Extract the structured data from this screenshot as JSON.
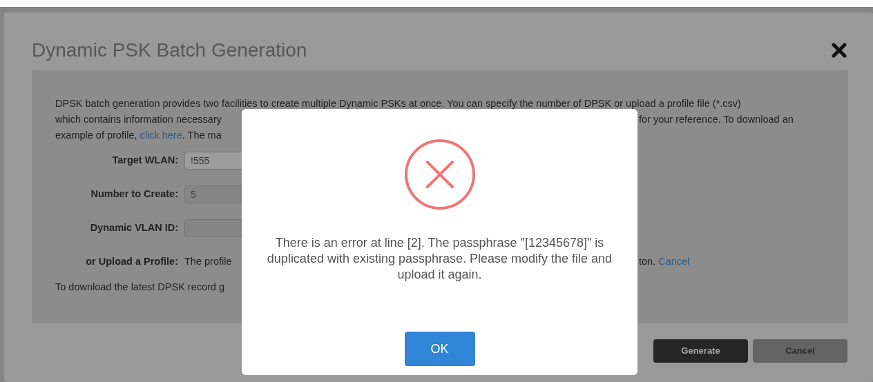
{
  "dialog": {
    "title": "Dynamic PSK Batch Generation",
    "description_lines": [
      {
        "left": [
          {
            "kind": "text",
            "text": "DPSK batch generation provides two facilities to create multiple Dynamic PSKs at once. You can specify the number of DPSK or upload a profile file (*.csv)"
          }
        ]
      },
      {
        "left": [
          {
            "kind": "text",
            "text": "which contains information necessary"
          }
        ],
        "right": [
          {
            "kind": "text",
            "text": "for your reference. To download an"
          }
        ]
      },
      {
        "left": [
          {
            "kind": "text",
            "text": "example of profile, "
          },
          {
            "kind": "link",
            "text": "click here"
          },
          {
            "kind": "text",
            "text": ". The ma"
          }
        ]
      }
    ],
    "fields": [
      {
        "label": "Target WLAN:",
        "value": "!555",
        "disabled": false
      },
      {
        "label": "Number to Create:",
        "value": "5",
        "disabled": true
      },
      {
        "label": "Dynamic VLAN ID:",
        "disabled": true
      }
    ],
    "upload": {
      "label": "or Upload a Profile:",
      "left": [
        {
          "kind": "text",
          "text": "The profile"
        }
      ],
      "right": [
        {
          "kind": "text",
          "text": "ton. "
        },
        {
          "kind": "link",
          "text": "Cancel"
        }
      ]
    },
    "footer_line": "To download the latest DPSK record g",
    "buttons": [
      {
        "label": "Generate",
        "kind": "primary"
      },
      {
        "label": "Cancel",
        "kind": "secondary"
      }
    ]
  },
  "alert": {
    "message": "There is an error at line [2]. The passphrase \"[12345678]\" is duplicated with existing passphrase. Please modify the file and upload it again.",
    "button": "OK"
  }
}
